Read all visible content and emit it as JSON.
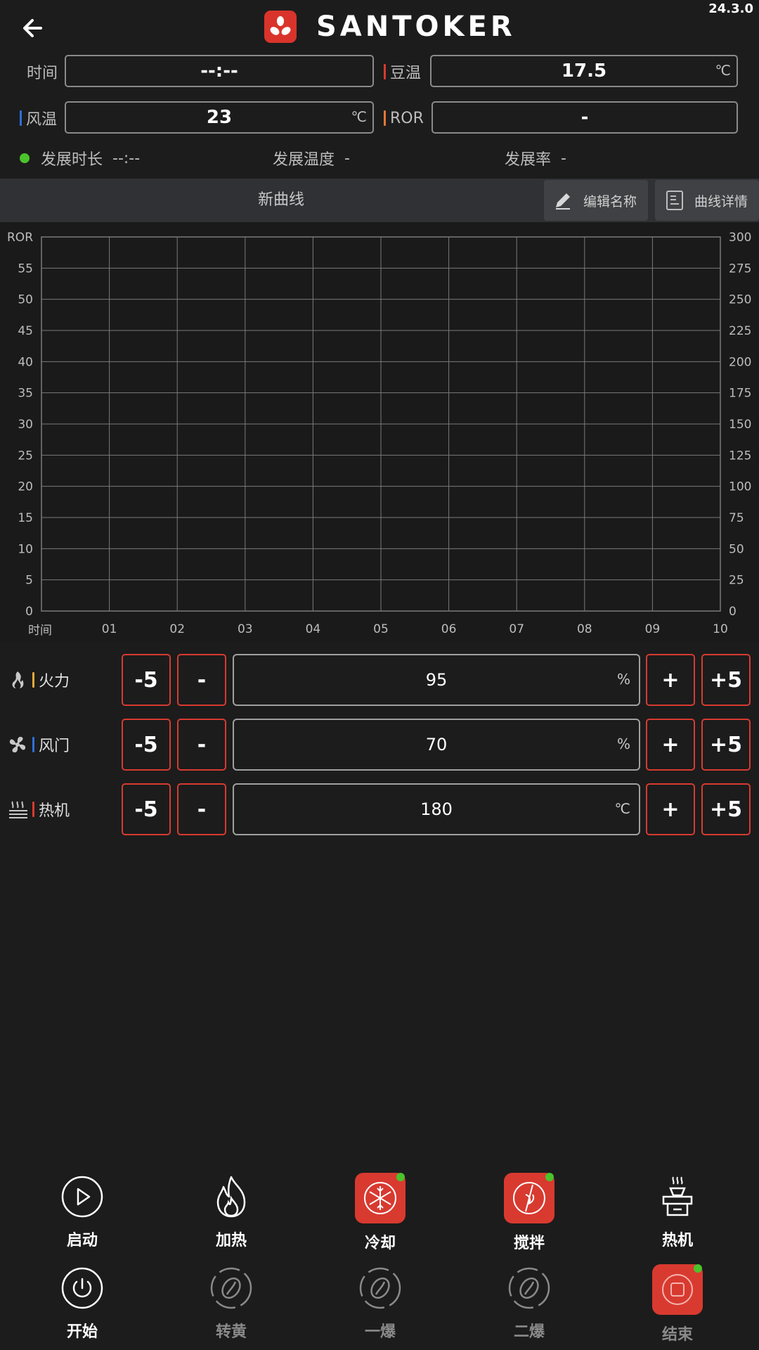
{
  "header": {
    "brand": "SANTOKER",
    "version": "24.3.0"
  },
  "readouts": {
    "time_label": "时间",
    "time_value": "--:--",
    "bean_label": "豆温",
    "bean_value": "17.5",
    "bean_unit": "℃",
    "air_label": "风温",
    "air_value": "23",
    "air_unit": "℃",
    "ror_label": "ROR",
    "ror_value": "-"
  },
  "development": {
    "duration_label": "发展时长",
    "duration_value": "--:--",
    "temp_label": "发展温度",
    "temp_value": "-",
    "rate_label": "发展率",
    "rate_value": "-"
  },
  "curve": {
    "name": "新曲线",
    "edit_label": "编辑名称",
    "details_label": "曲线详情"
  },
  "chart_data": {
    "type": "line",
    "series": [],
    "x_label": "时间",
    "x_ticks": [
      "01",
      "02",
      "03",
      "04",
      "05",
      "06",
      "07",
      "08",
      "09",
      "10"
    ],
    "left_axis_label": "ROR",
    "left_ticks": [
      "0",
      "5",
      "10",
      "15",
      "20",
      "25",
      "30",
      "35",
      "40",
      "45",
      "50",
      "55"
    ],
    "left_range": [
      0,
      60
    ],
    "right_ticks": [
      "0",
      "25",
      "50",
      "75",
      "100",
      "125",
      "150",
      "175",
      "200",
      "225",
      "250",
      "275",
      "300"
    ],
    "right_range": [
      0,
      300
    ],
    "grid": true
  },
  "controls": [
    {
      "label": "火力",
      "value": "95",
      "unit": "%",
      "minus5": "-5",
      "minus": "-",
      "plus": "+",
      "plus5": "+5",
      "color": "#e8a93a"
    },
    {
      "label": "风门",
      "value": "70",
      "unit": "%",
      "minus5": "-5",
      "minus": "-",
      "plus": "+",
      "plus5": "+5",
      "color": "#2f6fd6"
    },
    {
      "label": "热机",
      "value": "180",
      "unit": "℃",
      "minus5": "-5",
      "minus": "-",
      "plus": "+",
      "plus5": "+5",
      "color": "#d83a30"
    }
  ],
  "bottom": {
    "row1": [
      {
        "label": "启动",
        "icon": "play-icon",
        "active": false,
        "dot": false
      },
      {
        "label": "加热",
        "icon": "flame-icon",
        "active": false,
        "dot": false
      },
      {
        "label": "冷却",
        "icon": "snowflake-icon",
        "active": true,
        "dot": true
      },
      {
        "label": "搅拌",
        "icon": "stir-icon",
        "active": true,
        "dot": true
      },
      {
        "label": "热机",
        "icon": "preheat-icon",
        "active": false,
        "dot": false
      }
    ],
    "row2": [
      {
        "label": "开始",
        "icon": "power-icon",
        "enabled": true
      },
      {
        "label": "转黄",
        "icon": "bean-icon",
        "enabled": false
      },
      {
        "label": "一爆",
        "icon": "bean-icon",
        "enabled": false
      },
      {
        "label": "二爆",
        "icon": "bean-icon",
        "enabled": false
      },
      {
        "label": "结束",
        "icon": "stop-icon",
        "enabled": false,
        "active": true,
        "dot": true
      }
    ]
  },
  "colors": {
    "accent_red": "#d83a30",
    "active_dot": "#4bc32b",
    "bg": "#1c1c1c"
  }
}
